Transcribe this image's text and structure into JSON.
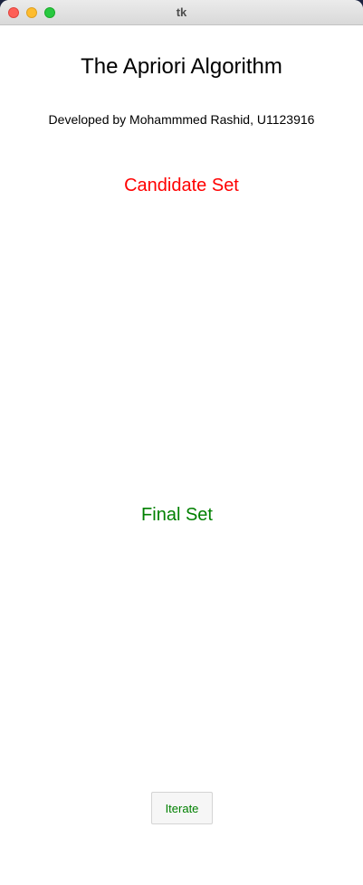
{
  "window": {
    "title": "tk"
  },
  "header": {
    "title": "The Apriori Algorithm",
    "credit": "Developed by Mohammmed Rashid, U1123916"
  },
  "candidate_set": {
    "heading": "Candidate Set",
    "heading_color": "#ff0000"
  },
  "final_set": {
    "heading": "Final Set",
    "heading_color": "#008000"
  },
  "controls": {
    "iterate_label": "Iterate",
    "iterate_color": "#008000"
  },
  "traffic_lights": {
    "close_color": "#fe5f57",
    "minimize_color": "#febc2e",
    "maximize_color": "#28c840"
  }
}
